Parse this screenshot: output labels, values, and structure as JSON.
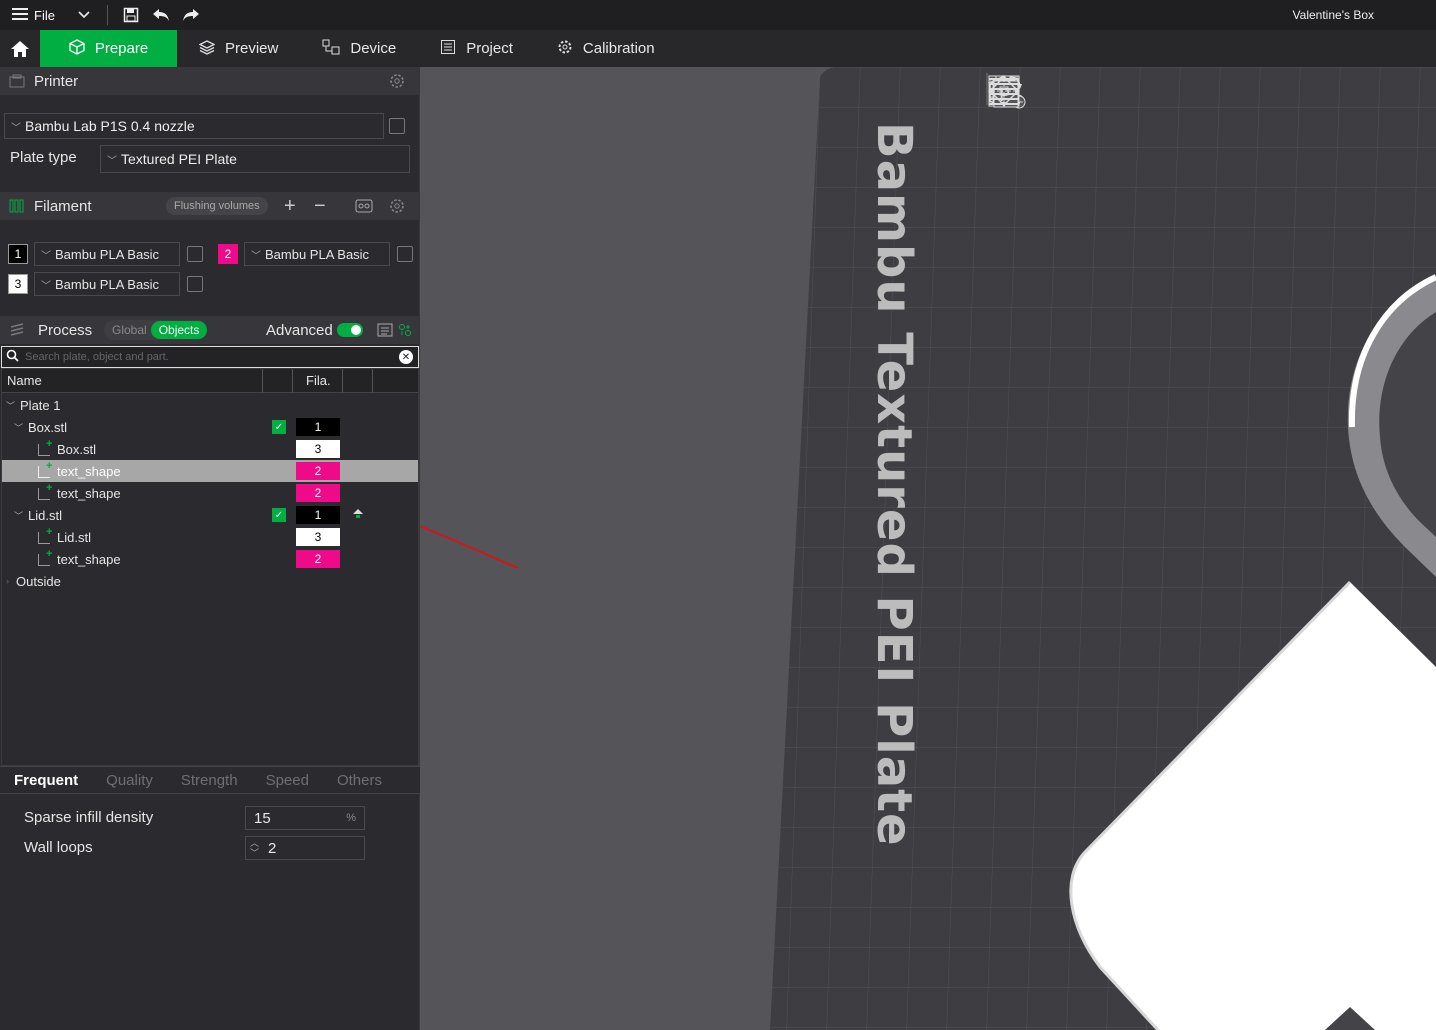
{
  "titlebar": {
    "file_label": "File",
    "window_title": "Valentine's Box"
  },
  "tabs": [
    {
      "label": "Prepare",
      "active": true
    },
    {
      "label": "Preview"
    },
    {
      "label": "Device"
    },
    {
      "label": "Project"
    },
    {
      "label": "Calibration"
    }
  ],
  "printer": {
    "section_label": "Printer",
    "printer_name": "Bambu Lab P1S 0.4 nozzle",
    "plate_type_label": "Plate type",
    "plate_type_value": "Textured PEI Plate"
  },
  "filament": {
    "section_label": "Filament",
    "flushing_label": "Flushing volumes",
    "slots": [
      {
        "num": "1",
        "name": "Bambu PLA Basic",
        "color": "#000000"
      },
      {
        "num": "2",
        "name": "Bambu PLA Basic",
        "color": "#ef0a8a"
      },
      {
        "num": "3",
        "name": "Bambu PLA Basic",
        "color": "#ffffff"
      }
    ]
  },
  "process": {
    "section_label": "Process",
    "global_label": "Global",
    "objects_label": "Objects",
    "advanced_label": "Advanced",
    "search_placeholder": "Search plate, object and part."
  },
  "tree": {
    "col_name": "Name",
    "col_fila": "Fila.",
    "rows": [
      {
        "label": "Plate 1",
        "fila": ""
      },
      {
        "label": "Box.stl",
        "fila": "1"
      },
      {
        "label": "Box.stl",
        "fila": "3"
      },
      {
        "label": "text_shape",
        "fila": "2"
      },
      {
        "label": "text_shape",
        "fila": "2"
      },
      {
        "label": "Lid.stl",
        "fila": "1"
      },
      {
        "label": "Lid.stl",
        "fila": "3"
      },
      {
        "label": "text_shape",
        "fila": "2"
      },
      {
        "label": "Outside",
        "fila": ""
      }
    ]
  },
  "param_tabs": [
    "Frequent",
    "Quality",
    "Strength",
    "Speed",
    "Others"
  ],
  "params": {
    "sparse_label": "Sparse infill density",
    "sparse_value": "15",
    "sparse_unit": "%",
    "wall_label": "Wall loops",
    "wall_value": "2"
  },
  "viewport": {
    "plate_text": "Bambu Textured PEI Plate"
  },
  "colors": {
    "accent": "#00ae42",
    "magenta": "#ef0a8a",
    "annotation": "#d01818"
  }
}
